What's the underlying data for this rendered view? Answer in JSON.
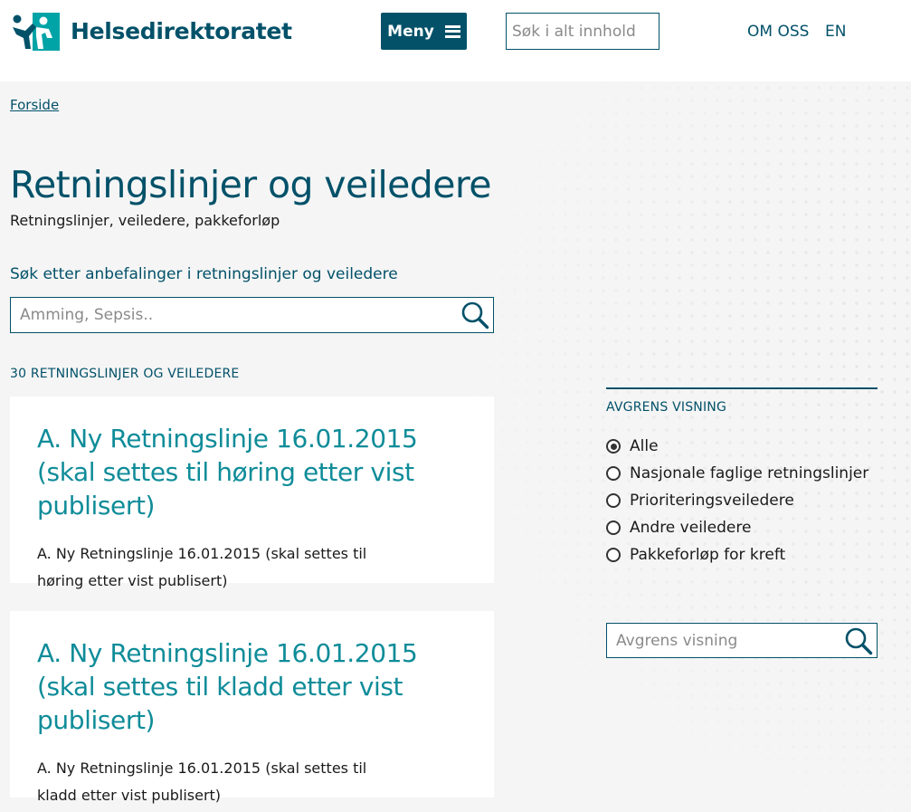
{
  "header": {
    "brand": "Helsedirektoratet",
    "menu_label": "Meny",
    "search_placeholder": "Søk i alt innhold",
    "links": [
      "OM OSS",
      "EN"
    ]
  },
  "breadcrumb": "Forside",
  "page": {
    "title": "Retningslinjer og veiledere",
    "subtitle": "Retningslinjer, veiledere, pakkeforløp",
    "search_label": "Søk etter anbefalinger i retningslinjer og veiledere",
    "search_placeholder": "Amming, Sepsis..",
    "result_count": "30 RETNINGSLINJER OG VEILEDERE"
  },
  "results": [
    {
      "title": "A. Ny Retningslinje 16.01.2015 (skal settes til høring etter vist publisert)",
      "description": "A. Ny Retningslinje 16.01.2015 (skal settes til høring etter vist publisert)"
    },
    {
      "title": "A. Ny Retningslinje 16.01.2015 (skal settes til kladd etter vist publisert)",
      "description": "A. Ny Retningslinje 16.01.2015 (skal settes til kladd etter vist publisert)"
    }
  ],
  "filter": {
    "heading": "AVGRENS VISNING",
    "options": [
      {
        "label": "Alle",
        "selected": true
      },
      {
        "label": "Nasjonale faglige retningslinjer",
        "selected": false
      },
      {
        "label": "Prioriteringsveiledere",
        "selected": false
      },
      {
        "label": "Andre veiledere",
        "selected": false
      },
      {
        "label": "Pakkeforløp for kreft",
        "selected": false
      }
    ],
    "search_placeholder": "Avgrens visning"
  },
  "colors": {
    "brand": "#025169",
    "link_teal": "#0f8c99",
    "logo_accent": "#00a3a6"
  }
}
